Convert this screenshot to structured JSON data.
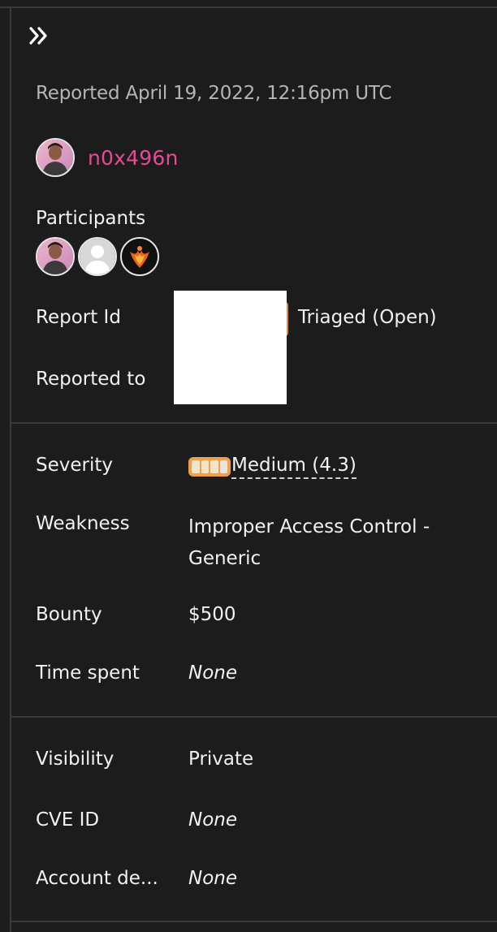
{
  "header": {
    "reported_text": "Reported April 19, 2022, 12:16pm UTC"
  },
  "reporter": {
    "username": "n0x496n",
    "avatar_icon": "user-avatar-photo-icon"
  },
  "participants": {
    "label": "Participants",
    "avatars": [
      "user-avatar-photo-icon",
      "default-user-avatar-icon",
      "phoenix-avatar-icon"
    ]
  },
  "meta": {
    "report_id_label": "Report Id",
    "reported_to_label": "Reported to",
    "state": "Triaged (Open)"
  },
  "details": {
    "severity_label": "Severity",
    "severity_value": "Medium (4.3)",
    "weakness_label": "Weakness",
    "weakness_value": "Improper Access Control - Generic",
    "bounty_label": "Bounty",
    "bounty_value": "$500",
    "time_spent_label": "Time spent",
    "time_spent_value": "None"
  },
  "disclosure": {
    "visibility_label": "Visibility",
    "visibility_value": "Private",
    "cve_label": "CVE ID",
    "cve_value": "None",
    "account_label": "Account de...",
    "account_value": "None"
  },
  "colors": {
    "accent_pink": "#e64a95",
    "severity_orange": "#f0a04b",
    "background": "#1c1c1c"
  }
}
